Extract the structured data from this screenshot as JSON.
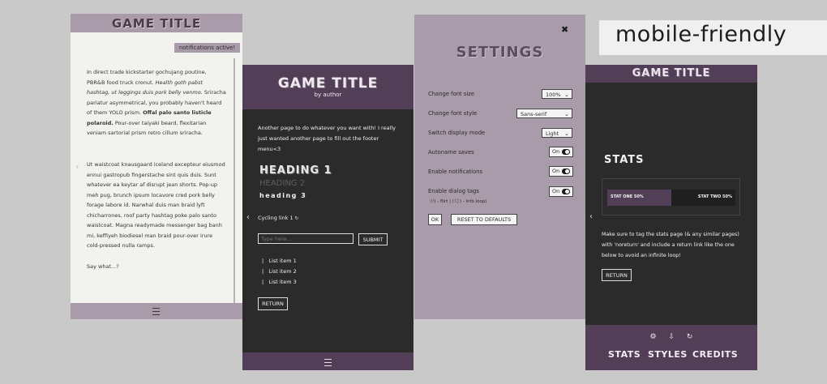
{
  "tag": {
    "label": "mobile-friendly"
  },
  "screen1": {
    "title": "GAME TITLE",
    "notification": "notifications active!",
    "para1_a": "In direct trade kickstarter gochujang poutine, PBR&B food truck cronut. ",
    "para1_b": "Health goth pabst hashtag, ut leggings duis pork belly venmo.",
    "para1_c": " Sriracha pariatur asymmetrical, you probably haven't heard of them YOLO prism. ",
    "para1_d": "Offal palo santo listicle polaroid.",
    "para1_e": " Pour-over taiyaki beard, flexitarian veniam sartorial prism retro cillum sriracha.",
    "para2": "Ut waistcoat knausgaard iceland excepteur eiusmod ennui gastropub fingerstache sint quis duis. Sunt whatever ea keytar af disrupt jean shorts. Pop-up meh pug, brunch ipsum locavore cred pork belly forage labore id. Narwhal duis man braid lyft chicharrones, roof party hashtag poke palo santo waistcoat. Magna readymade messenger bag banh mi, keffiyeh biodiesel man braid pour-over irure cold-pressed nulla ramps.",
    "para3": "Say what...?",
    "prev_arrow": "‹"
  },
  "screen2": {
    "title": "GAME TITLE",
    "byline": "by author",
    "intro": "Another page to do whatever you want with! I really just wanted another page to fill out the footer menu<3",
    "heading1": "HEADING 1",
    "heading2": "HEADING 2",
    "heading3": "heading 3",
    "cycle_link": "Cycling link 1",
    "cycle_icon": "↻",
    "input_placeholder": "Type here...",
    "submit": "SUBMIT",
    "list": [
      "List item 1",
      "List item 2",
      "List item 3"
    ],
    "list_marker": "|",
    "return": "RETURN",
    "prev_arrow": "‹"
  },
  "screen3": {
    "close": "✖",
    "title": "SETTINGS",
    "rows": [
      {
        "label": "Change font size",
        "value": "100%"
      },
      {
        "label": "Change font style",
        "value": "Sans-serif"
      },
      {
        "label": "Switch display mode",
        "value": "Light"
      },
      {
        "label": "Autoname saves",
        "value": "On"
      },
      {
        "label": "Enable notifications",
        "value": "On"
      },
      {
        "label": "Enable dialog tags",
        "value": "On"
      }
    ],
    "dialog_hint": "(!) - flirt | (🗨) - info loop)",
    "ok": "OK",
    "reset": "RESET TO DEFAULTS"
  },
  "screen4": {
    "title": "GAME TITLE",
    "stats_title": "STATS",
    "stat_left": "STAT ONE 50%",
    "stat_right": "STAT TWO 50%",
    "stat_fraction": 0.5,
    "note": "Make sure to tag the stats page (& any similar pages) with 'noreturn' and include a return link like the one below to avoid an infinite loop!",
    "return": "RETURN",
    "icons": [
      "⚙",
      "⇩",
      "↻"
    ],
    "nav": [
      "STATS",
      "STYLES",
      "CREDITS"
    ],
    "prev_arrow": "‹"
  },
  "colors": {
    "purple_dark": "#533e57",
    "purple_light": "#a99ba9",
    "panel_dark": "#2b2b2b",
    "paper": "#f2f2ef"
  }
}
